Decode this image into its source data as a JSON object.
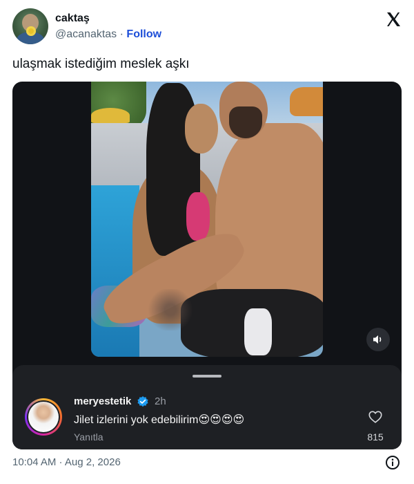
{
  "author": {
    "name": "caktaş",
    "handle": "@acanaktas",
    "separator": "·",
    "follow_label": "Follow"
  },
  "tweet": {
    "text": "ulaşmak istediğim meslek aşkı",
    "timestamp": "10:04 AM · Aug 2, 2026"
  },
  "embedded_comment": {
    "username": "meryestetik",
    "time": "2h",
    "text": "Jilet izlerini yok edebilirim😍😍😍😍",
    "reply_label": "Yanıtla",
    "like_count": "815"
  },
  "icons": {
    "brand": "x-logo-icon",
    "volume": "volume-icon",
    "verified": "verified-badge-icon",
    "heart": "heart-icon",
    "info": "info-icon"
  },
  "colors": {
    "follow_link": "#1d4ed8",
    "verified_badge": "#1d9bf0",
    "media_background": "#111317",
    "sheet_background": "#1e2024"
  }
}
